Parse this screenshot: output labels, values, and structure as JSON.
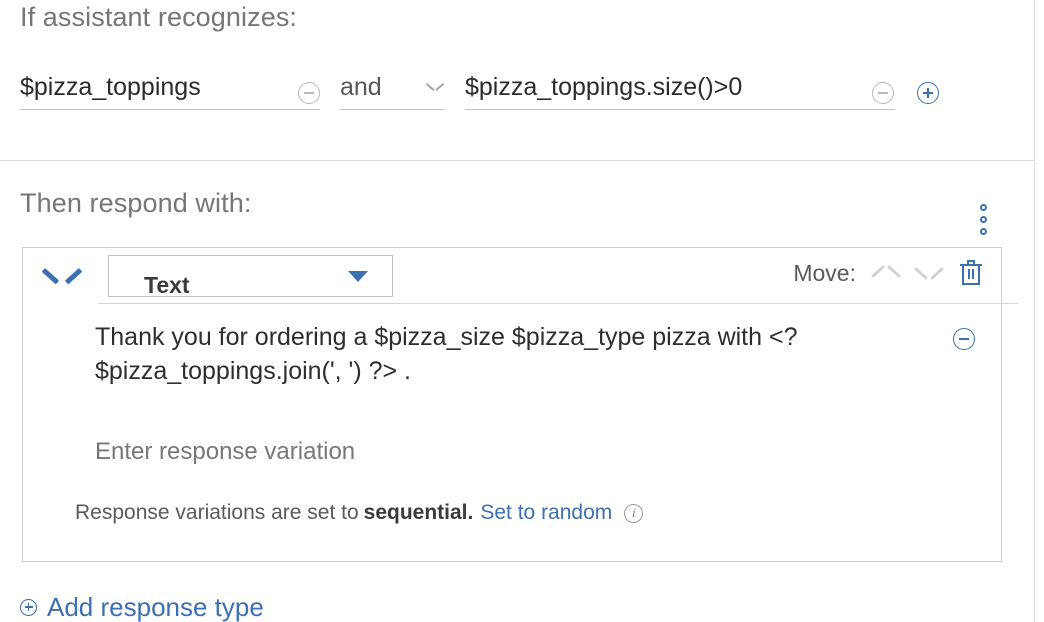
{
  "condition_section": {
    "heading": "If assistant recognizes:",
    "condition_1": {
      "value": "$pizza_toppings",
      "remove_icon": "circle-minus-icon"
    },
    "operator": {
      "value": "and",
      "chevron_icon": "chevron-down-icon"
    },
    "condition_2": {
      "value": "$pizza_toppings.size()>0",
      "remove_icon": "circle-minus-icon",
      "add_icon": "circle-plus-icon"
    }
  },
  "respond_section": {
    "heading": "Then respond with:",
    "overflow_menu_icon": "overflow-menu-icon",
    "response_card": {
      "collapse_icon": "chevron-down-icon",
      "response_type": "Text",
      "type_dropdown_icon": "triangle-down-icon",
      "move_label": "Move:",
      "move_up_icon": "chevron-up-icon",
      "move_down_icon": "chevron-down-icon",
      "delete_icon": "trash-icon",
      "response_text": "Thank you for ordering a $pizza_size $pizza_type pizza with <? $pizza_toppings.join(', ') ?> .",
      "response_remove_icon": "circle-minus-icon",
      "variation_placeholder": "Enter response variation",
      "variation_note_prefix": "Response variations are set to",
      "variation_mode": "sequential.",
      "variation_toggle_link": "Set to random",
      "info_icon": "info-icon",
      "info_icon_glyph": "i"
    },
    "add_response_type": {
      "label": "Add response type",
      "icon": "circle-plus-icon"
    }
  },
  "colors": {
    "link_blue": "#3d70b2",
    "heading_gray": "#767676",
    "disabled_gray": "#b9b9b9",
    "border_gray": "#cfcfcf"
  }
}
